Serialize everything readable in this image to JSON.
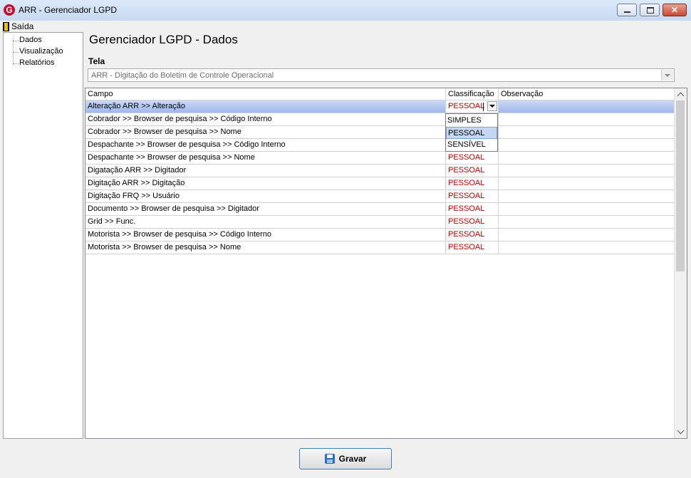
{
  "window": {
    "title": "ARR - Gerenciador LGPD",
    "app_icon": "G"
  },
  "menu": {
    "exit_label": "Saída"
  },
  "tree": {
    "items": [
      {
        "label": "Dados"
      },
      {
        "label": "Visualização"
      },
      {
        "label": "Relatórios"
      }
    ]
  },
  "main": {
    "title": "Gerenciador LGPD - Dados",
    "tela_label": "Tela",
    "tela_value": "ARR - Digitação do Boletim de Controle Operacional"
  },
  "grid": {
    "headers": {
      "campo": "Campo",
      "classificacao": "Classificação",
      "observacao": "Observação"
    },
    "rows": [
      {
        "campo": "Alteração ARR >> Alteração",
        "classificacao": "PESSOAL",
        "observacao": ""
      },
      {
        "campo": "Cobrador >> Browser de pesquisa >> Código Interno",
        "classificacao": "",
        "observacao": ""
      },
      {
        "campo": "Cobrador >> Browser de pesquisa >> Nome",
        "classificacao": "",
        "observacao": ""
      },
      {
        "campo": "Despachante >> Browser de pesquisa >> Código Interno",
        "classificacao": "",
        "observacao": ""
      },
      {
        "campo": "Despachante >> Browser de pesquisa >> Nome",
        "classificacao": "PESSOAL",
        "observacao": ""
      },
      {
        "campo": "Digatação ARR >> Digitador",
        "classificacao": "PESSOAL",
        "observacao": ""
      },
      {
        "campo": "Digitação ARR >> Digitação",
        "classificacao": "PESSOAL",
        "observacao": ""
      },
      {
        "campo": "Digitação FRQ >> Usuário",
        "classificacao": "PESSOAL",
        "observacao": ""
      },
      {
        "campo": "Documento >> Browser de pesquisa >> Digitador",
        "classificacao": "PESSOAL",
        "observacao": ""
      },
      {
        "campo": "Grid >> Func.",
        "classificacao": "PESSOAL",
        "observacao": ""
      },
      {
        "campo": "Motorista >> Browser de pesquisa >> Código Interno",
        "classificacao": "PESSOAL",
        "observacao": ""
      },
      {
        "campo": "Motorista >> Browser de pesquisa >> Nome",
        "classificacao": "PESSOAL",
        "observacao": ""
      }
    ],
    "dropdown_options": [
      "SIMPLES",
      "PESSOAL",
      "SENSÍVEL"
    ],
    "dropdown_selected": "PESSOAL"
  },
  "footer": {
    "save_label": "Gravar"
  },
  "colors": {
    "accent": "#c6d7f3",
    "classification_text": "#c00000"
  }
}
